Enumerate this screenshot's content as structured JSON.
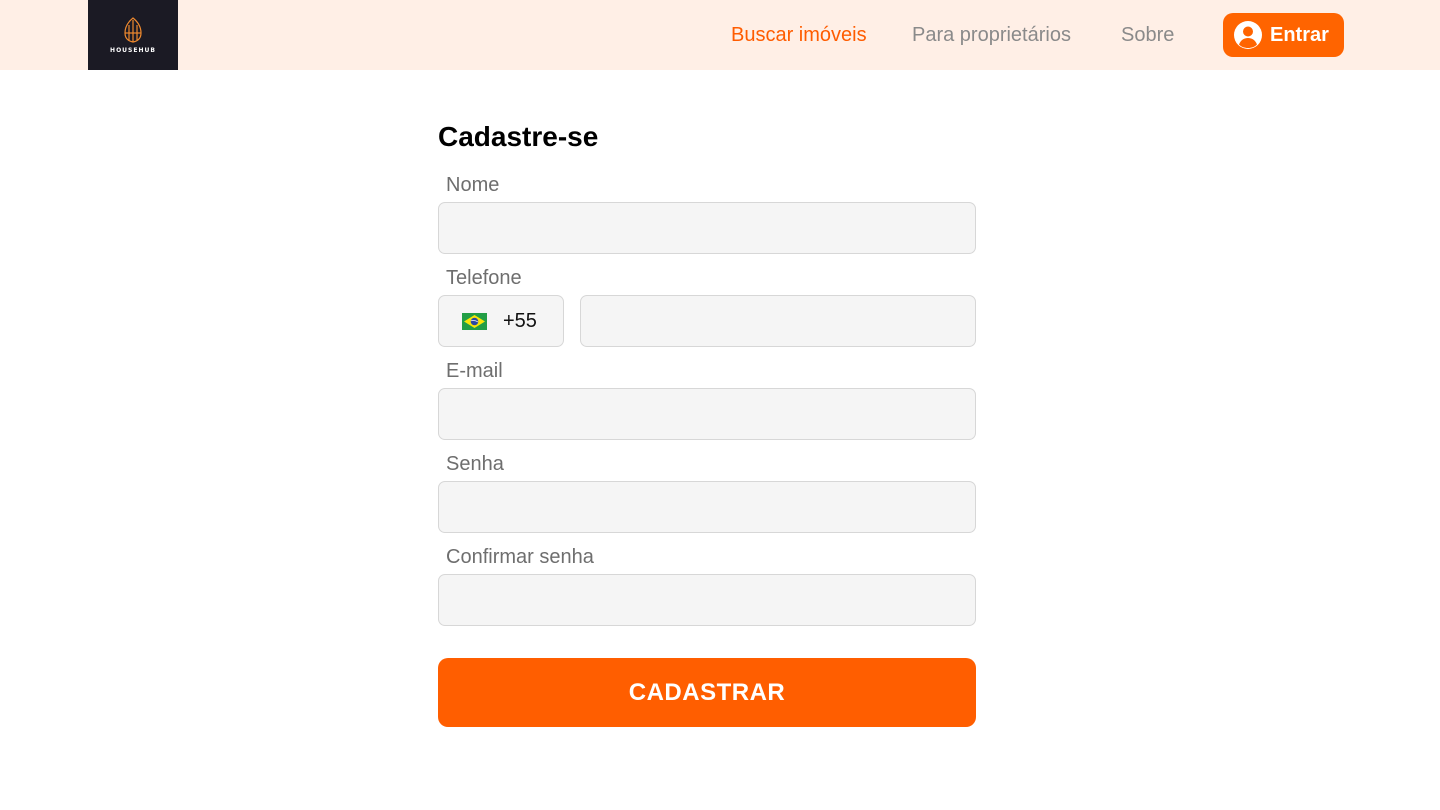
{
  "brand": {
    "name": "HOUSEHUB"
  },
  "nav": {
    "links": [
      {
        "label": "Buscar imóveis",
        "active": true
      },
      {
        "label": "Para proprietários",
        "active": false
      },
      {
        "label": "Sobre",
        "active": false
      }
    ],
    "enter_label": "Entrar",
    "enter_icon": "user-circle-icon"
  },
  "form": {
    "title": "Cadastre-se",
    "name_label": "Nome",
    "name_value": "",
    "phone_label": "Telefone",
    "phone_country_flag": "brazil-flag-icon",
    "phone_code": "+55",
    "phone_value": "",
    "email_label": "E-mail",
    "email_value": "",
    "password_label": "Senha",
    "password_value": "",
    "confirm_label": "Confirmar senha",
    "confirm_value": "",
    "submit_label": "CADASTRAR"
  },
  "colors": {
    "accent": "#ff5e00",
    "header_bg": "#ffefe6",
    "logo_bg": "#1b1a24",
    "input_bg": "#f5f5f5"
  }
}
